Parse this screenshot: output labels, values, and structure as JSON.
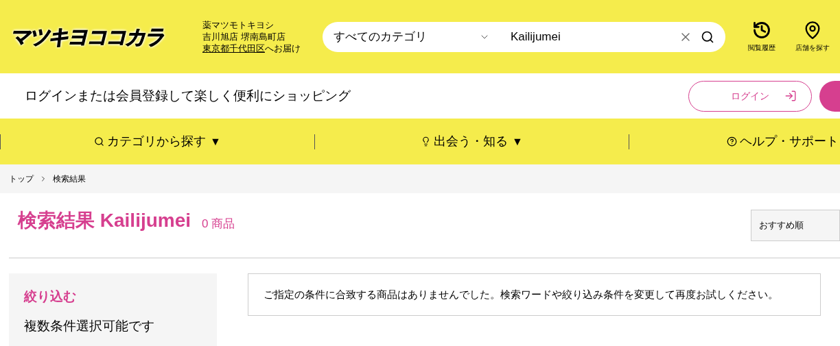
{
  "header": {
    "logo": "マツキヨココカラ",
    "store": {
      "line_1": "薬マツモトキヨシ",
      "line_2": "吉川旭店 堺南島町店",
      "delivery_area": "東京都千代田区",
      "delivery_suffix": "へお届け"
    },
    "search": {
      "category": "すべてのカテゴリ",
      "query": "Kailijumei"
    },
    "actions": [
      {
        "label": "閲覧履歴",
        "kind": "history"
      },
      {
        "label": "店舗を探す",
        "kind": "store"
      }
    ]
  },
  "login_bar": {
    "message": "ログインまたは会員登録して楽しく便利にショッピング",
    "login_button": "ログイン"
  },
  "nav": [
    {
      "label": "カテゴリから探す",
      "kind": "search",
      "arrow": "▼"
    },
    {
      "label": "出会う・知る",
      "kind": "bulb",
      "arrow": "▼"
    },
    {
      "label": "ヘルプ・サポート",
      "kind": "help"
    }
  ],
  "breadcrumb": [
    "トップ",
    "検索結果"
  ],
  "results": {
    "title": "検索結果 Kailijumei",
    "count": "0 商品",
    "sort": "おすすめ順",
    "message": "ご指定の条件に合致する商品はありませんでした。検索ワードや絞り込み条件を変更して再度お試しください。"
  },
  "filter": {
    "title": "絞り込む",
    "note": "複数条件選択可能です"
  }
}
